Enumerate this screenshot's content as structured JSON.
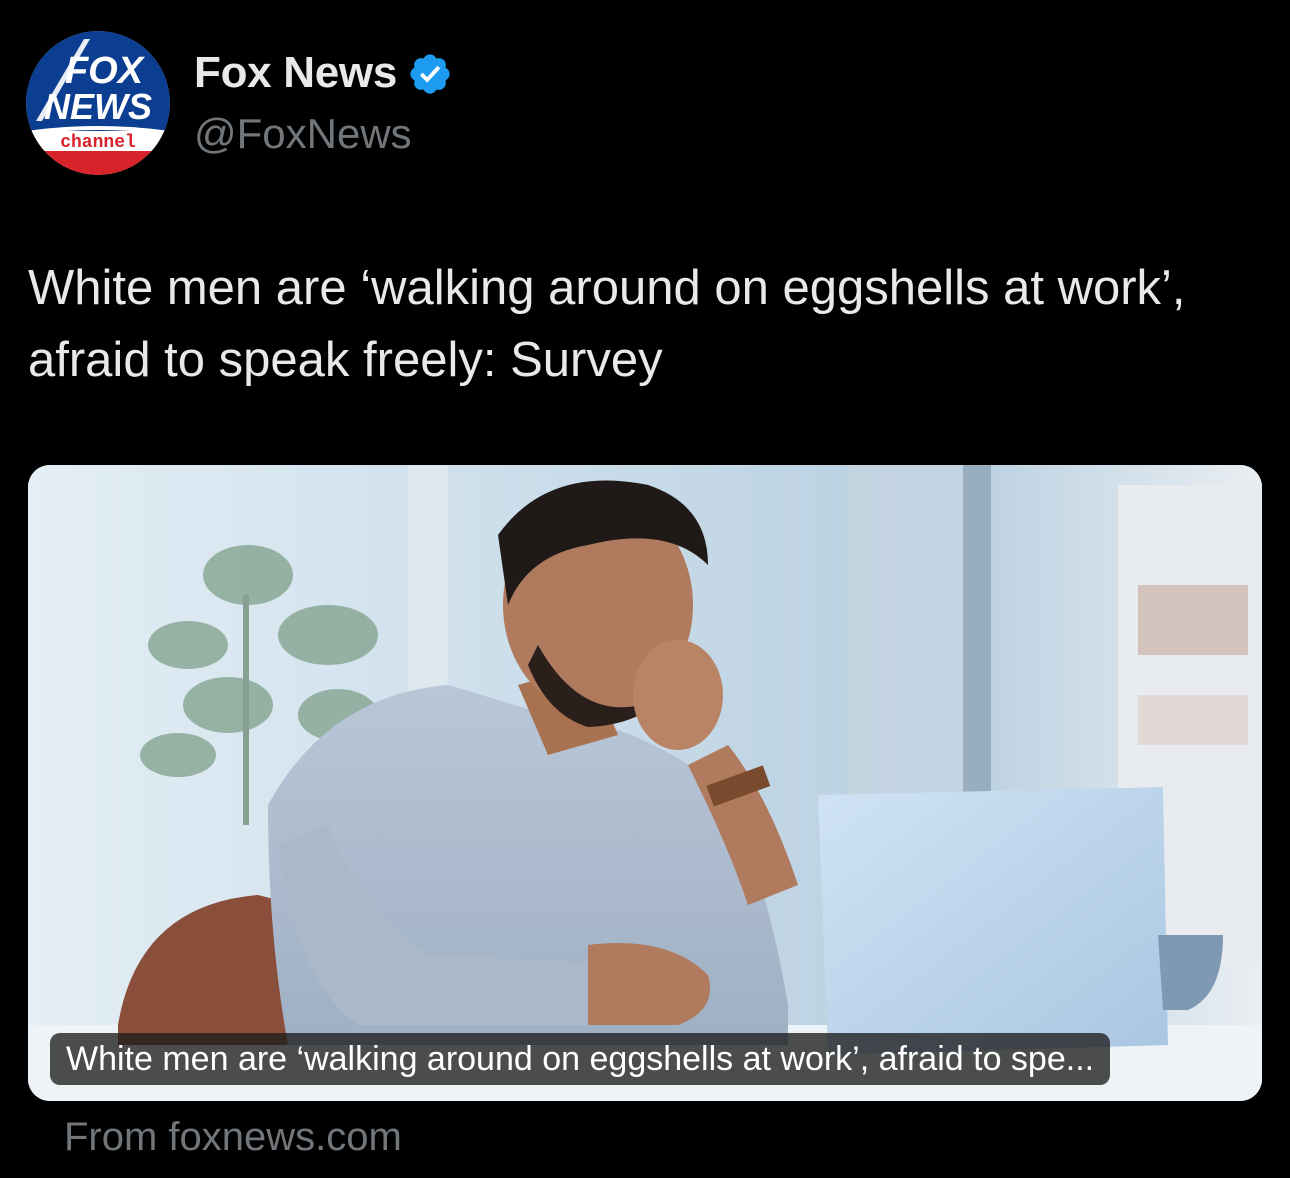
{
  "author": {
    "name": "Fox News",
    "handle": "@FoxNews",
    "verified": true,
    "avatar_icon": "fox-news-channel-logo",
    "avatar_text": [
      "FOX",
      "NEWS",
      "channel"
    ],
    "accent_color": "#1d9bf0"
  },
  "tweet": {
    "text": "White men are ‘walking around on eggshells at work’, afraid to speak freely: Survey"
  },
  "link_card": {
    "image_description_icon": "stressed-man-at-laptop-photo",
    "caption": "White men are ‘walking around on eggshells at work’, afraid to spe...",
    "source": "From foxnews.com"
  },
  "colors": {
    "background": "#000000",
    "primary_text": "#e7e9ea",
    "secondary_text": "#71767b",
    "verified_blue": "#1d9bf0",
    "fox_blue": "#0d3a8c",
    "fox_red": "#d8232a"
  }
}
